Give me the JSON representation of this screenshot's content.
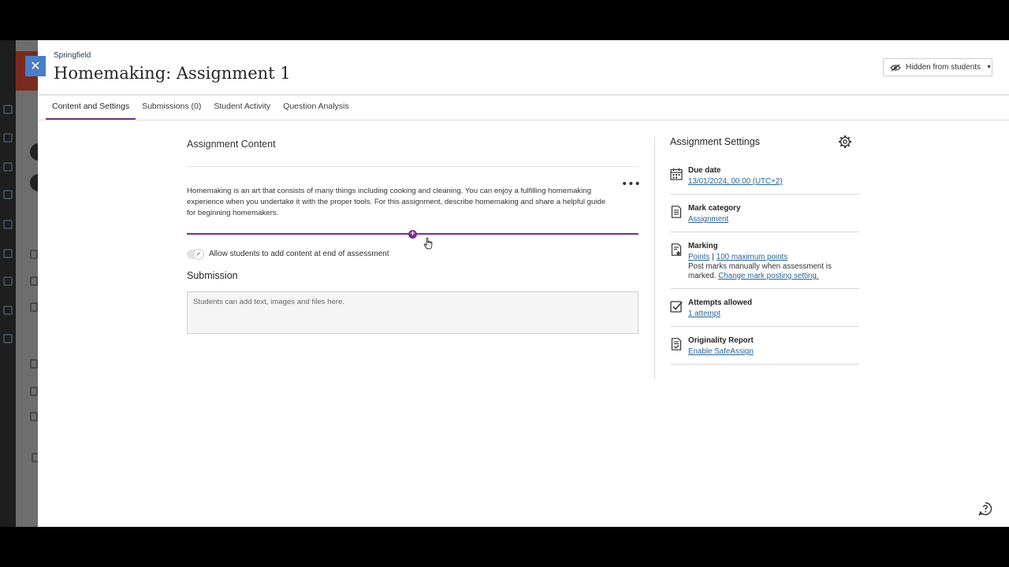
{
  "panel": {
    "breadcrumb": "Springfield",
    "title": "Homemaking: Assignment 1",
    "visibility_label": "Hidden from students"
  },
  "tabs": [
    {
      "label": "Content and Settings"
    },
    {
      "label": "Submissions (0)"
    },
    {
      "label": "Student Activity"
    },
    {
      "label": "Question Analysis"
    }
  ],
  "content": {
    "heading": "Assignment Content",
    "description": "Homemaking is an art that consists of many things including cooking and cleaning. You can enjoy a fulfilling homemaking experience when you undertake it with the proper tools. For this assignment, describe homemaking and share a helpful guide for beginning homemakers.",
    "more_label": "•••",
    "toggle_label": "Allow students to add content at end of assessment",
    "submission_heading": "Submission",
    "submission_placeholder": "Students can add text, images and files here."
  },
  "settings": {
    "title": "Assignment Settings",
    "due_date": {
      "title": "Due date",
      "value": "13/01/2024, 00:00 (UTC+2)"
    },
    "mark_category": {
      "title": "Mark category",
      "value": "Assignment"
    },
    "marking": {
      "title": "Marking",
      "points": "Points",
      "separator": "|",
      "max_points": "100 maximum points",
      "note": "Post marks manually when assessment is marked.",
      "change_link": "Change mark posting setting."
    },
    "attempts": {
      "title": "Attempts allowed",
      "value": "1 attempt"
    },
    "originality": {
      "title": "Originality Report",
      "value": "Enable SafeAssign"
    }
  },
  "colors": {
    "accent": "#7b2d91",
    "link": "#2a6496",
    "close_button": "#4a7dc8"
  }
}
